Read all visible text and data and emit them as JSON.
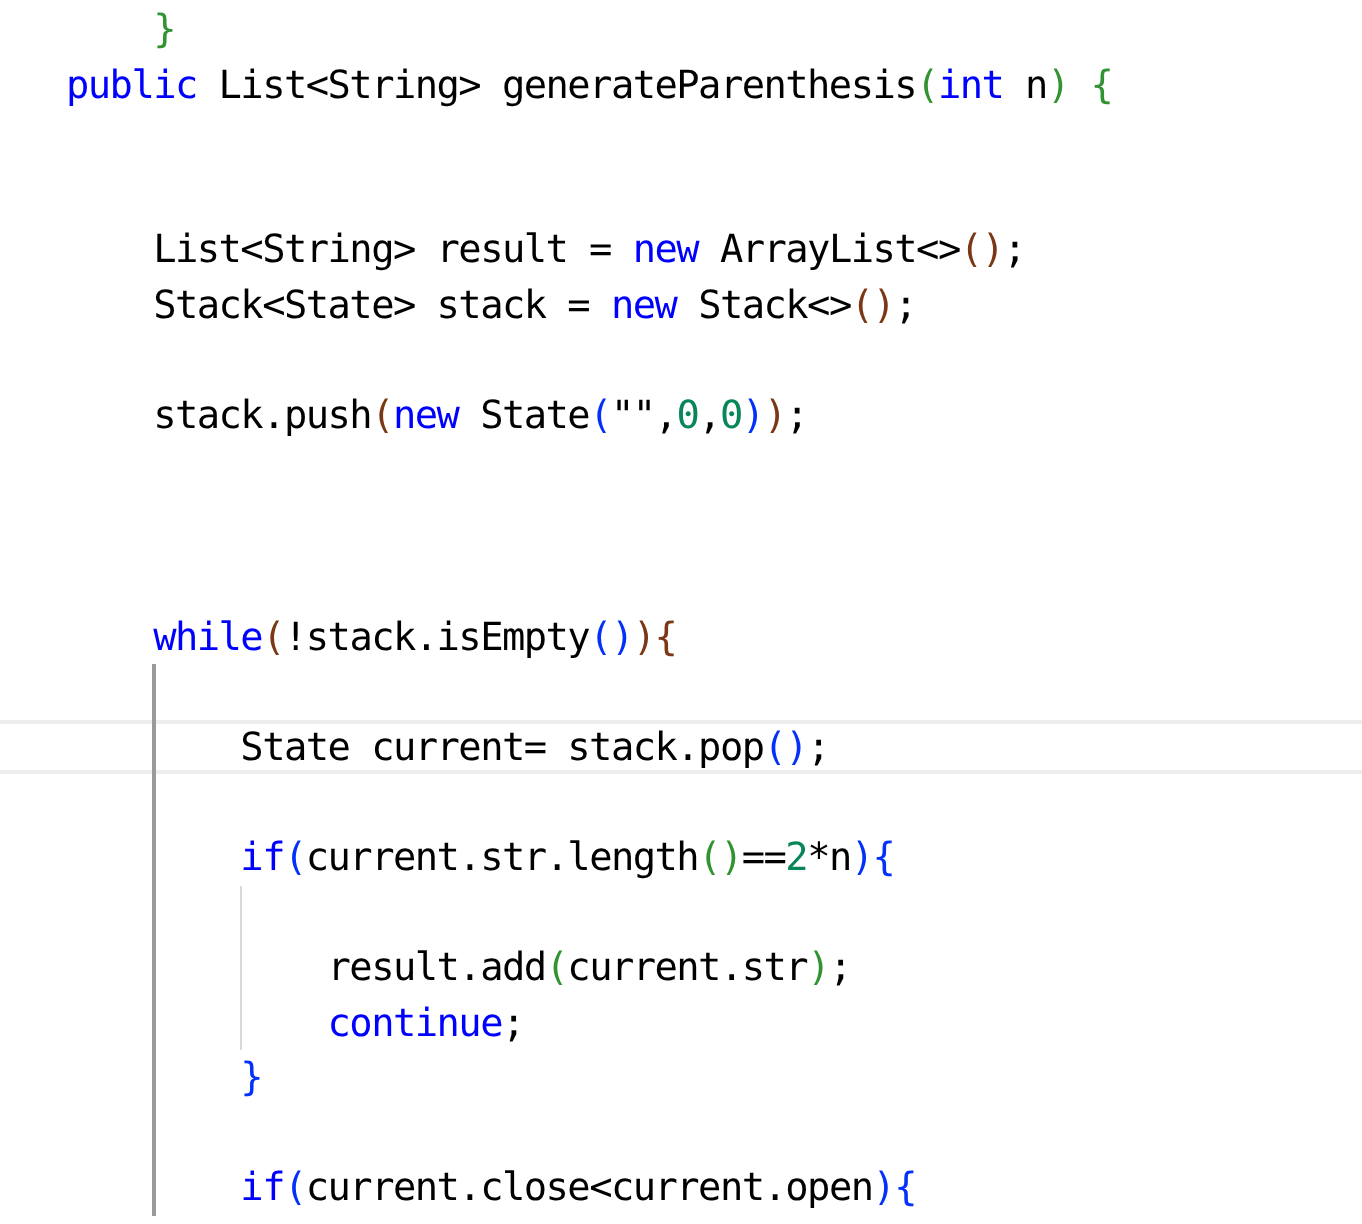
{
  "editor": {
    "lines": [
      {
        "kind": "code",
        "current": false,
        "tokens": [
          {
            "kind": "brace-b",
            "text": "    }"
          }
        ]
      },
      {
        "kind": "code",
        "current": false,
        "tokens": [
          {
            "kind": "keyword",
            "text": "public"
          },
          {
            "kind": "text",
            "text": " List<String> generateParenthesis"
          },
          {
            "kind": "brace-b",
            "text": "("
          },
          {
            "kind": "keyword",
            "text": "int"
          },
          {
            "kind": "text",
            "text": " n"
          },
          {
            "kind": "brace-b",
            "text": ")"
          },
          {
            "kind": "brace-b",
            "text": " {"
          }
        ]
      },
      {
        "kind": "blank"
      },
      {
        "kind": "blank"
      },
      {
        "kind": "code",
        "current": false,
        "tokens": [
          {
            "kind": "text",
            "text": "    List<String> result = "
          },
          {
            "kind": "keyword",
            "text": "new"
          },
          {
            "kind": "text",
            "text": " ArrayList<>"
          },
          {
            "kind": "brace-c",
            "text": "()"
          },
          {
            "kind": "text",
            "text": ";"
          }
        ]
      },
      {
        "kind": "code",
        "current": false,
        "tokens": [
          {
            "kind": "text",
            "text": "    Stack<State> stack = "
          },
          {
            "kind": "keyword",
            "text": "new"
          },
          {
            "kind": "text",
            "text": " Stack<>"
          },
          {
            "kind": "brace-c",
            "text": "()"
          },
          {
            "kind": "text",
            "text": ";"
          }
        ]
      },
      {
        "kind": "blank"
      },
      {
        "kind": "code",
        "current": false,
        "tokens": [
          {
            "kind": "text",
            "text": "    stack.push"
          },
          {
            "kind": "brace-c",
            "text": "("
          },
          {
            "kind": "keyword",
            "text": "new"
          },
          {
            "kind": "text",
            "text": " State"
          },
          {
            "kind": "brace-a",
            "text": "("
          },
          {
            "kind": "text",
            "text": "\"\","
          },
          {
            "kind": "number",
            "text": "0"
          },
          {
            "kind": "text",
            "text": ","
          },
          {
            "kind": "number",
            "text": "0"
          },
          {
            "kind": "brace-a",
            "text": ")"
          },
          {
            "kind": "brace-c",
            "text": ")"
          },
          {
            "kind": "text",
            "text": ";"
          }
        ]
      },
      {
        "kind": "blank"
      },
      {
        "kind": "blank"
      },
      {
        "kind": "blank"
      },
      {
        "kind": "code",
        "current": false,
        "tokens": [
          {
            "kind": "keyword",
            "text": "    while"
          },
          {
            "kind": "brace-c",
            "text": "("
          },
          {
            "kind": "text",
            "text": "!stack.isEmpty"
          },
          {
            "kind": "brace-a",
            "text": "()"
          },
          {
            "kind": "brace-c",
            "text": "){"
          }
        ]
      },
      {
        "kind": "blank"
      },
      {
        "kind": "code",
        "current": true,
        "tokens": [
          {
            "kind": "text",
            "text": "        State current= stack.pop"
          },
          {
            "kind": "brace-a",
            "text": "()"
          },
          {
            "kind": "text",
            "text": ";"
          }
        ]
      },
      {
        "kind": "blank"
      },
      {
        "kind": "code",
        "current": false,
        "tokens": [
          {
            "kind": "keyword",
            "text": "        if"
          },
          {
            "kind": "brace-a",
            "text": "("
          },
          {
            "kind": "text",
            "text": "current.str.length"
          },
          {
            "kind": "brace-b",
            "text": "()"
          },
          {
            "kind": "text",
            "text": "=="
          },
          {
            "kind": "number",
            "text": "2"
          },
          {
            "kind": "text",
            "text": "*n"
          },
          {
            "kind": "brace-a",
            "text": "){"
          }
        ]
      },
      {
        "kind": "blank"
      },
      {
        "kind": "code",
        "current": false,
        "tokens": [
          {
            "kind": "text",
            "text": "            result.add"
          },
          {
            "kind": "brace-b",
            "text": "("
          },
          {
            "kind": "text",
            "text": "current.str"
          },
          {
            "kind": "brace-b",
            "text": ")"
          },
          {
            "kind": "text",
            "text": ";"
          }
        ]
      },
      {
        "kind": "code",
        "current": false,
        "tokens": [
          {
            "kind": "keyword",
            "text": "            continue"
          },
          {
            "kind": "text",
            "text": ";"
          }
        ]
      },
      {
        "kind": "code",
        "current": false,
        "tokens": [
          {
            "kind": "brace-a",
            "text": "        }"
          }
        ]
      },
      {
        "kind": "blank"
      },
      {
        "kind": "code",
        "current": false,
        "tokens": [
          {
            "kind": "keyword",
            "text": "        if"
          },
          {
            "kind": "brace-a",
            "text": "("
          },
          {
            "kind": "text",
            "text": "current.close<current.open"
          },
          {
            "kind": "brace-a",
            "text": "){"
          }
        ]
      }
    ]
  }
}
